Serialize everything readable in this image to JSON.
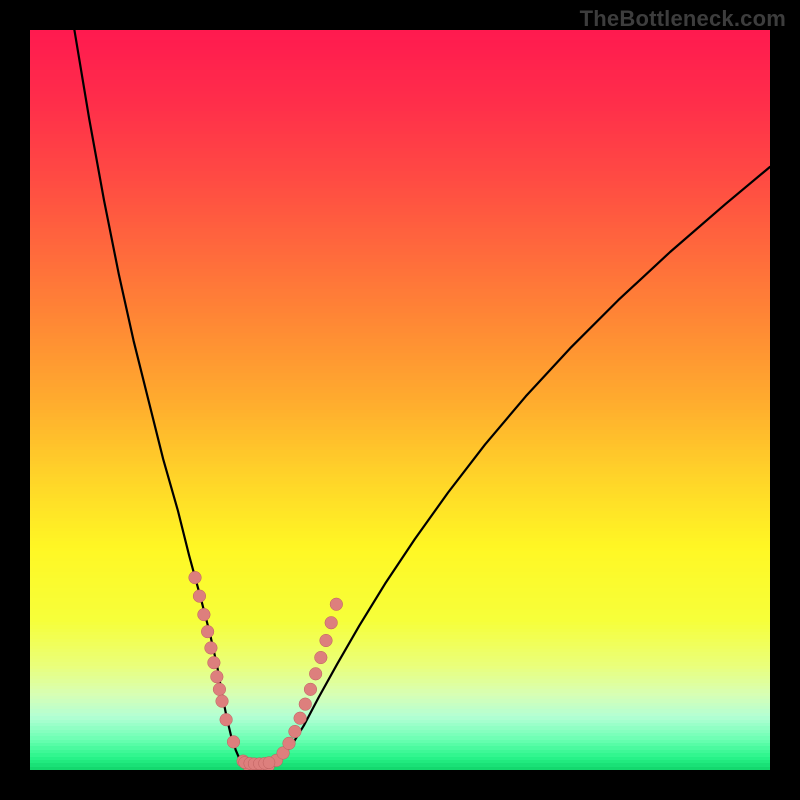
{
  "watermark": "TheBottleneck.com",
  "chart_data": {
    "type": "line",
    "title": "",
    "xlabel": "",
    "ylabel": "",
    "xlim": [
      0,
      100
    ],
    "ylim": [
      0,
      100
    ],
    "grid": false,
    "legend": false,
    "gradient_stops": [
      {
        "pos": 0.0,
        "color": "#ff1a4f"
      },
      {
        "pos": 0.1,
        "color": "#ff2f4a"
      },
      {
        "pos": 0.2,
        "color": "#ff4b43"
      },
      {
        "pos": 0.3,
        "color": "#ff6a3c"
      },
      {
        "pos": 0.4,
        "color": "#ff8a34"
      },
      {
        "pos": 0.5,
        "color": "#ffab2e"
      },
      {
        "pos": 0.6,
        "color": "#ffd229"
      },
      {
        "pos": 0.7,
        "color": "#fff724"
      },
      {
        "pos": 0.8,
        "color": "#f6ff3a"
      },
      {
        "pos": 0.86,
        "color": "#eaff7a"
      },
      {
        "pos": 0.9,
        "color": "#d7ffb5"
      },
      {
        "pos": 0.93,
        "color": "#b3ffd4"
      },
      {
        "pos": 0.96,
        "color": "#6dffb4"
      },
      {
        "pos": 0.985,
        "color": "#29f58a"
      },
      {
        "pos": 1.0,
        "color": "#14d86e"
      }
    ],
    "series": [
      {
        "name": "left-branch",
        "x": [
          6.0,
          8.0,
          10.0,
          12.0,
          14.0,
          16.0,
          18.0,
          20.0,
          21.5,
          23.0,
          24.3,
          25.3,
          26.0,
          26.6,
          27.2,
          27.8,
          28.4,
          29.0
        ],
        "y": [
          100.0,
          88.0,
          77.0,
          67.0,
          58.0,
          50.0,
          42.0,
          35.0,
          29.0,
          23.5,
          18.5,
          14.0,
          10.0,
          7.0,
          4.5,
          2.7,
          1.3,
          0.4
        ]
      },
      {
        "name": "valley",
        "x": [
          29.0,
          29.5,
          30.0,
          30.5,
          31.0,
          31.6,
          32.3,
          33.0,
          33.8,
          34.6,
          35.4
        ],
        "y": [
          0.4,
          0.2,
          0.15,
          0.15,
          0.2,
          0.35,
          0.6,
          1.0,
          1.6,
          2.4,
          3.4
        ]
      },
      {
        "name": "right-branch",
        "x": [
          35.4,
          37.0,
          39.0,
          41.5,
          44.5,
          48.0,
          52.0,
          56.5,
          61.5,
          67.0,
          73.0,
          79.5,
          86.5,
          94.0,
          100.0
        ],
        "y": [
          3.4,
          6.0,
          9.8,
          14.3,
          19.5,
          25.2,
          31.2,
          37.5,
          44.0,
          50.5,
          57.0,
          63.5,
          70.0,
          76.5,
          81.5
        ]
      }
    ],
    "dots_left": {
      "name": "dots-left",
      "x": [
        22.3,
        22.9,
        23.5,
        24.0,
        24.45,
        24.85,
        25.25,
        25.6,
        25.95,
        26.5,
        27.5,
        28.8,
        29.6,
        30.4
      ],
      "y": [
        26.0,
        23.5,
        21.0,
        18.7,
        16.5,
        14.5,
        12.6,
        10.9,
        9.3,
        6.8,
        3.8,
        1.2,
        0.55,
        0.35
      ]
    },
    "dots_right": {
      "name": "dots-right",
      "x": [
        31.4,
        32.2,
        33.3,
        34.2,
        35.0,
        35.8,
        36.5,
        37.2,
        37.9,
        38.6,
        39.3,
        40.0,
        40.7,
        41.4
      ],
      "y": [
        0.45,
        0.55,
        1.3,
        2.3,
        3.6,
        5.2,
        7.0,
        8.9,
        10.9,
        13.0,
        15.2,
        17.5,
        19.9,
        22.4
      ]
    },
    "dots_floor": {
      "name": "dots-floor",
      "x": [
        29.0,
        29.7,
        30.3,
        31.0,
        31.7,
        32.3
      ],
      "y": [
        1.0,
        0.9,
        0.85,
        0.85,
        0.9,
        1.0
      ]
    }
  }
}
